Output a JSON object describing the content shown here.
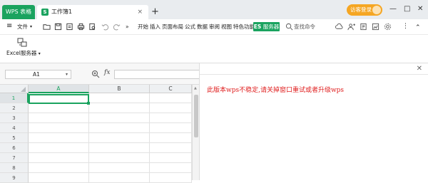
{
  "titlebar": {
    "app_tab": "WPS 表格",
    "doc_tab": "工作簿1",
    "doc_icon_letter": "S",
    "close_glyph": "×",
    "new_tab_glyph": "+",
    "login_label": "访客登录",
    "min_glyph": "—",
    "max_glyph": "□",
    "close_window_glyph": "✕"
  },
  "toolbar": {
    "menu_glyph": "≡",
    "file_label": "文件",
    "file_arrow": "▾",
    "more_glyph": "»",
    "tabs": [
      "开始",
      "插入",
      "页面布局",
      "公式",
      "数据",
      "审阅",
      "视图",
      "特色功能"
    ],
    "es_badge_prefix": "ES",
    "es_badge_label": "服务器",
    "search_label": "查找命令",
    "more_vert": "⋮",
    "collapse_glyph": "⌃"
  },
  "ribbon": {
    "excel_server_label": "Excel服务器",
    "excel_server_arrow": "▾"
  },
  "formula_bar": {
    "name_box_value": "A1",
    "name_box_arrow": "▾",
    "fx_label": "fx",
    "formula_value": ""
  },
  "grid": {
    "columns": [
      "A",
      "B",
      "C"
    ],
    "rows": [
      "1",
      "2",
      "3",
      "4",
      "5",
      "6",
      "7",
      "8",
      "9"
    ],
    "selected_cell": "A1"
  },
  "panel": {
    "close_glyph": "✕",
    "message": "此版本wps不稳定,请关掉窗口重试或者升级wps"
  },
  "colors": {
    "accent": "#1aa35f",
    "login_bg": "#f5a623",
    "message": "#e02020"
  }
}
